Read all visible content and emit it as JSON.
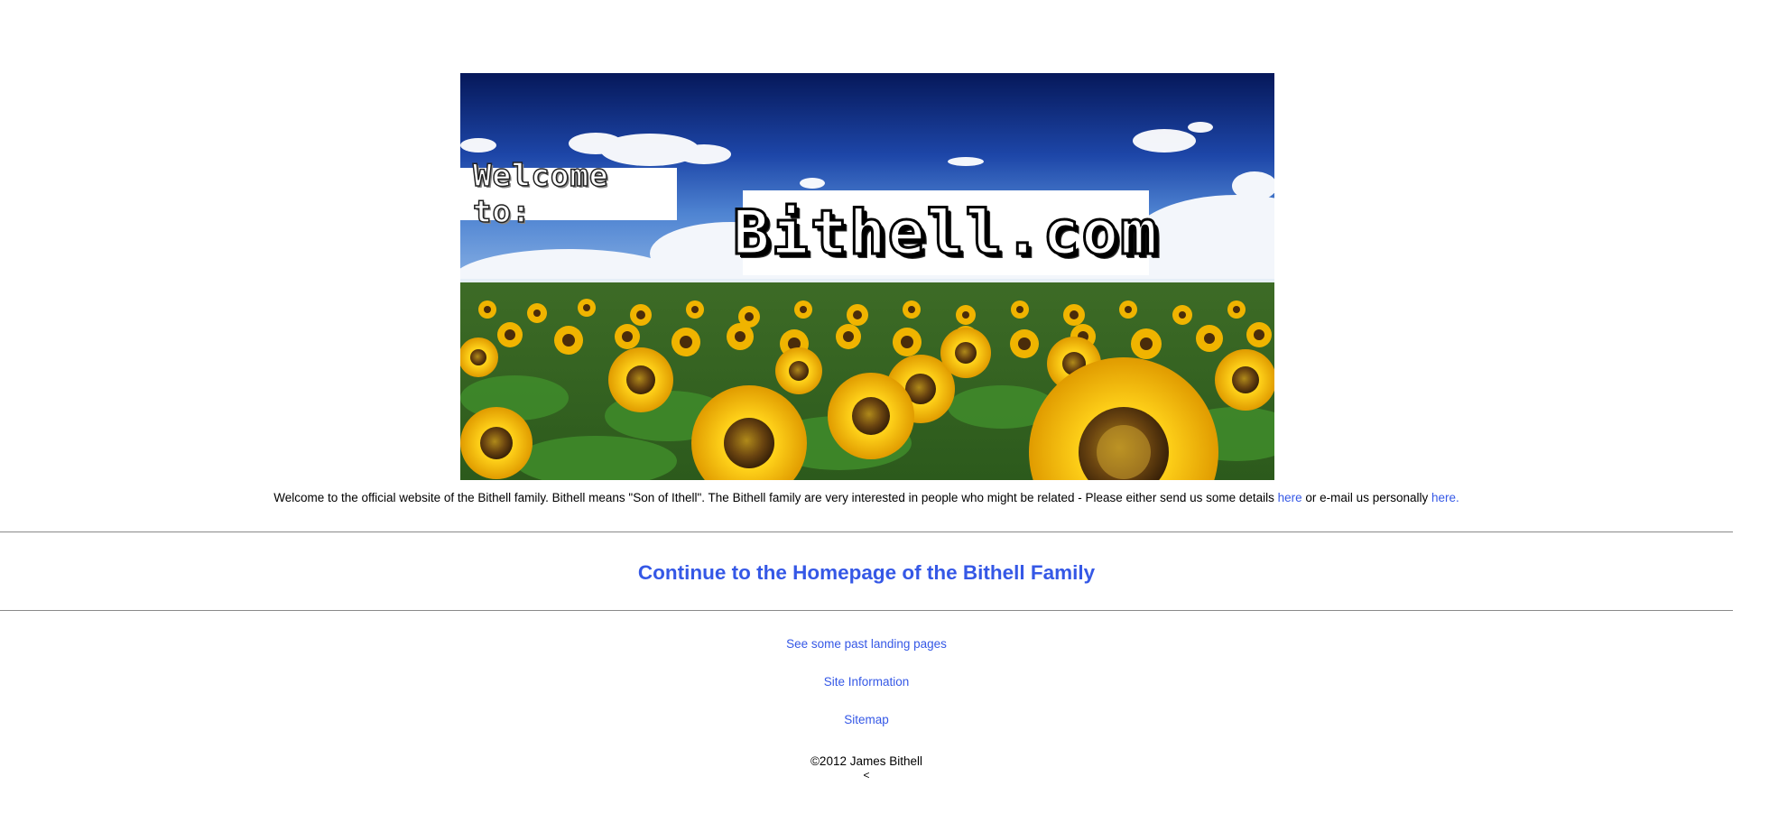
{
  "hero": {
    "welcome_text": "Welcome to:",
    "site_title": "Bithell.com",
    "image_alt": "Sunflower field under blue sky"
  },
  "intro": {
    "text_before": "Welcome to the official website of the Bithell family. Bithell means \"Son of Ithell\". The Bithell family are very interested in people who might be related - Please either send us some details ",
    "link1": "here",
    "text_middle": " or e-mail us personally ",
    "link2": "here."
  },
  "continue_link": "Continue to the Homepage of the Bithell Family",
  "links": [
    "See some past landing pages",
    "Site Information",
    "Sitemap"
  ],
  "footer": {
    "copyright": "©2012 James Bithell",
    "caret": "<"
  },
  "colors": {
    "link": "#3558e6",
    "rule": "#8a8a8a",
    "sky_top": "#0a1f63",
    "sunflower": "#f5c400"
  }
}
